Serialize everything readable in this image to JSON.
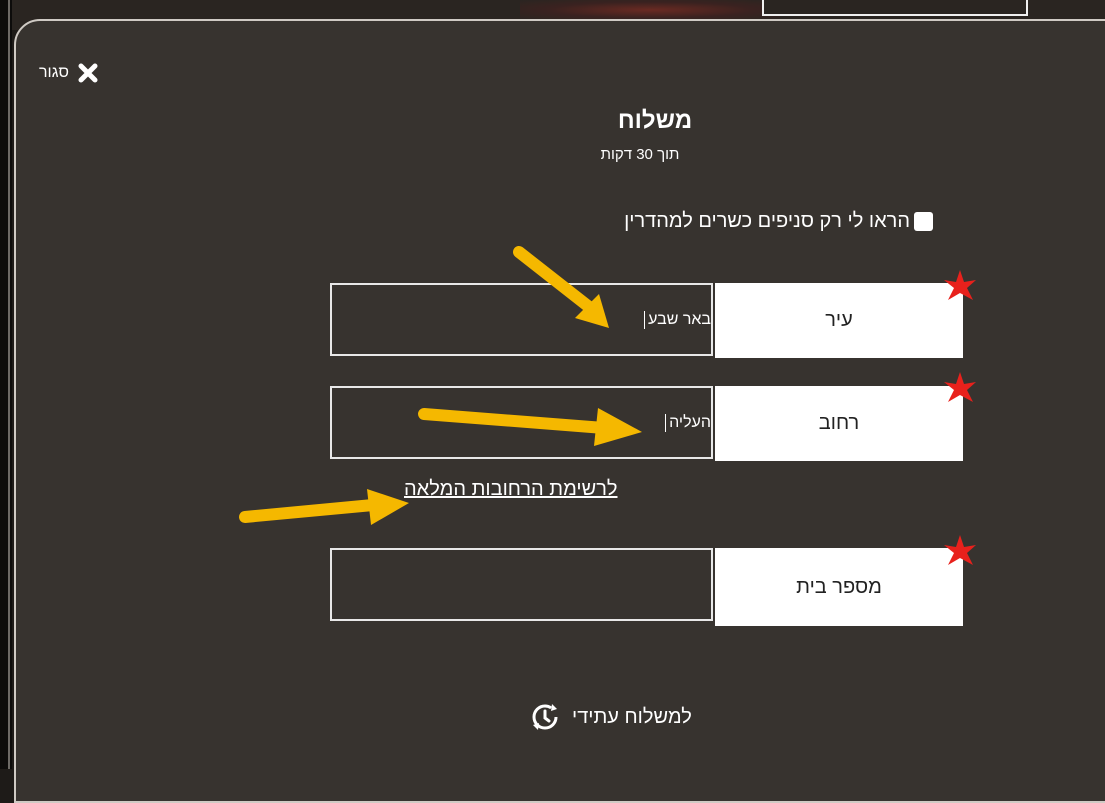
{
  "close": {
    "label": "סגור",
    "icon": "close-icon"
  },
  "header": {
    "title": "משלוח",
    "subtitle": "תוך 30 דקות"
  },
  "kosher_filter": {
    "label": "הראו לי רק סניפים כשרים למהדרין",
    "checked": false
  },
  "fields": {
    "city": {
      "label": "עיר",
      "value": "באר שבע",
      "required": true
    },
    "street": {
      "label": "רחוב",
      "value": "העליה",
      "required": true
    },
    "house_number": {
      "label": "מספר בית",
      "value": "",
      "required": true
    }
  },
  "street_list_link": "לרשימת הרחובות המלאה",
  "future_delivery": {
    "label": "למשלוח עתידי",
    "icon": "clock-refresh-icon"
  },
  "colors": {
    "modal_bg": "#37332f",
    "required_star": "#e8211c",
    "annotation_arrow": "#f5b800"
  }
}
